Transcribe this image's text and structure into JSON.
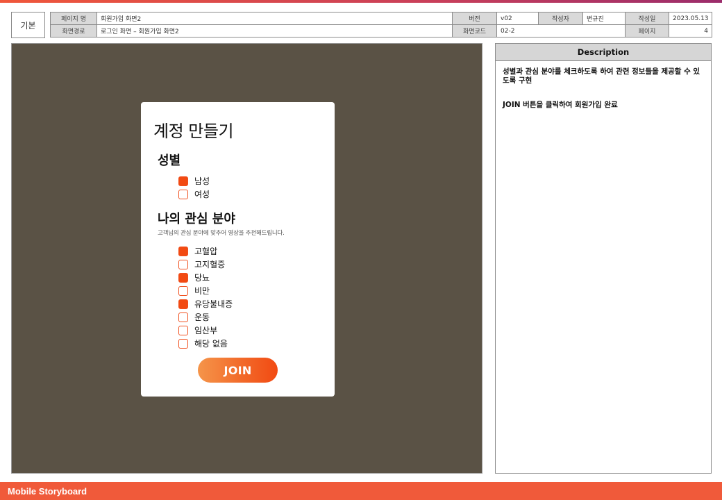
{
  "header": {
    "kibon": "기본",
    "labels": {
      "page_name": "페이지 명",
      "version": "버전",
      "author": "작성자",
      "date": "작성일",
      "path": "화면경로",
      "code": "화면코드",
      "page": "페이지"
    },
    "values": {
      "page_name": "회원가입 화면2",
      "version": "v02",
      "author": "변규진",
      "date": "2023.05.13",
      "path": "로그인 화면 – 회원가입 화면2",
      "code": "02-2",
      "page": "4"
    }
  },
  "card": {
    "title": "계정 만들기",
    "gender": {
      "title": "성별",
      "options": [
        {
          "label": "남성",
          "checked": true
        },
        {
          "label": "여성",
          "checked": false
        }
      ]
    },
    "interests": {
      "title": "나의 관심 분야",
      "subtitle": "고객님의 관심 분야에 맞추어 영상을 추천해드립니다.",
      "options": [
        {
          "label": "고혈압",
          "checked": true
        },
        {
          "label": "고지혈증",
          "checked": false
        },
        {
          "label": "당뇨",
          "checked": true
        },
        {
          "label": "비만",
          "checked": false
        },
        {
          "label": "유당불내증",
          "checked": true
        },
        {
          "label": "운동",
          "checked": false
        },
        {
          "label": "임산부",
          "checked": false
        },
        {
          "label": "해당 없음",
          "checked": false
        }
      ]
    },
    "join_label": "JOIN"
  },
  "description": {
    "title": "Description",
    "lines": [
      "성별과 관심 분야를 체크하도록 하여 관련 정보들을 제공할 수 있도록 구현",
      "JOIN 버튼을 클릭하여 회원가입 완료"
    ]
  },
  "footer": {
    "title": "Mobile Storyboard"
  },
  "colors": {
    "accent": "#f24a12",
    "canvas": "#5a5245",
    "footer": "#f05a3a"
  }
}
